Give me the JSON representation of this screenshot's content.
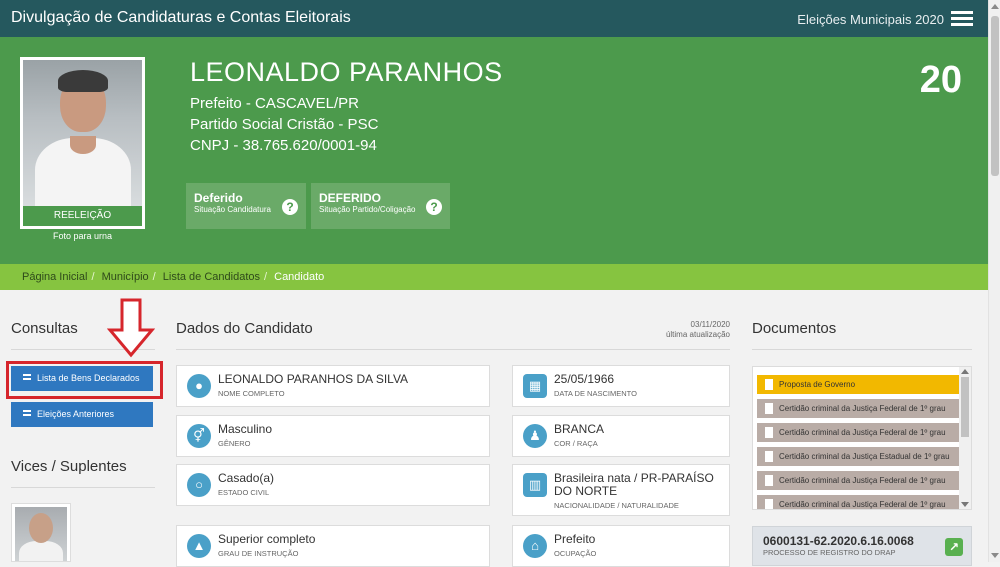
{
  "topbar": {
    "title": "Divulgação de Candidaturas e Contas Eleitorais",
    "election": "Eleições Municipais 2020"
  },
  "candidate": {
    "name": "LEONALDO PARANHOS",
    "role": "Prefeito - CASCAVEL/PR",
    "party": "Partido Social Cristão - PSC",
    "cnpj": "CNPJ - 38.765.620/0001-94",
    "number": "20",
    "photo_badge": "REELEIÇÃO",
    "photo_caption": "Foto para urna"
  },
  "status": [
    {
      "value": "Deferido",
      "label": "Situação Candidatura"
    },
    {
      "value": "DEFERIDO",
      "label": "Situação Partido/Coligação"
    }
  ],
  "breadcrumb": [
    "Página Inicial",
    "Município",
    "Lista de Candidatos",
    "Candidato"
  ],
  "consultas": {
    "heading": "Consultas",
    "buttons": [
      "Lista de Bens Declarados",
      "Eleições Anteriores"
    ]
  },
  "vices": {
    "heading": "Vices / Suplentes"
  },
  "dados": {
    "heading": "Dados do Candidato",
    "update_date": "03/11/2020",
    "update_label": "última atualização",
    "fields": [
      {
        "value": "LEONALDO PARANHOS DA SILVA",
        "label": "NOME COMPLETO",
        "icon": "person-icon"
      },
      {
        "value": "25/05/1966",
        "label": "DATA DE NASCIMENTO",
        "icon": "calendar-icon"
      },
      {
        "value": "Masculino",
        "label": "GÊNERO",
        "icon": "gender-icon"
      },
      {
        "value": "BRANCA",
        "label": "COR / RAÇA",
        "icon": "race-icon"
      },
      {
        "value": "Casado(a)",
        "label": "ESTADO CIVIL",
        "icon": "ring-icon"
      },
      {
        "value": "Brasileira nata / PR-PARAÍSO DO NORTE",
        "label": "NACIONALIDADE / NATURALIDADE",
        "icon": "map-icon"
      },
      {
        "value": "Superior completo",
        "label": "GRAU DE INSTRUÇÃO",
        "icon": "graduation-icon"
      },
      {
        "value": "Prefeito",
        "label": "OCUPAÇÃO",
        "icon": "building-icon"
      }
    ]
  },
  "documentos": {
    "heading": "Documentos",
    "items": [
      "Proposta de Governo",
      "Certidão criminal da Justiça Federal de 1º grau",
      "Certidão criminal da Justiça Federal de 1º grau",
      "Certidão criminal da Justiça Estadual de 1º grau",
      "Certidão criminal da Justiça Federal de 1º grau",
      "Certidão criminal da Justiça Federal de 1º grau"
    ],
    "drap_number": "0600131-62.2020.6.16.0068",
    "drap_label": "PROCESSO DE REGISTRO DO DRAP"
  }
}
